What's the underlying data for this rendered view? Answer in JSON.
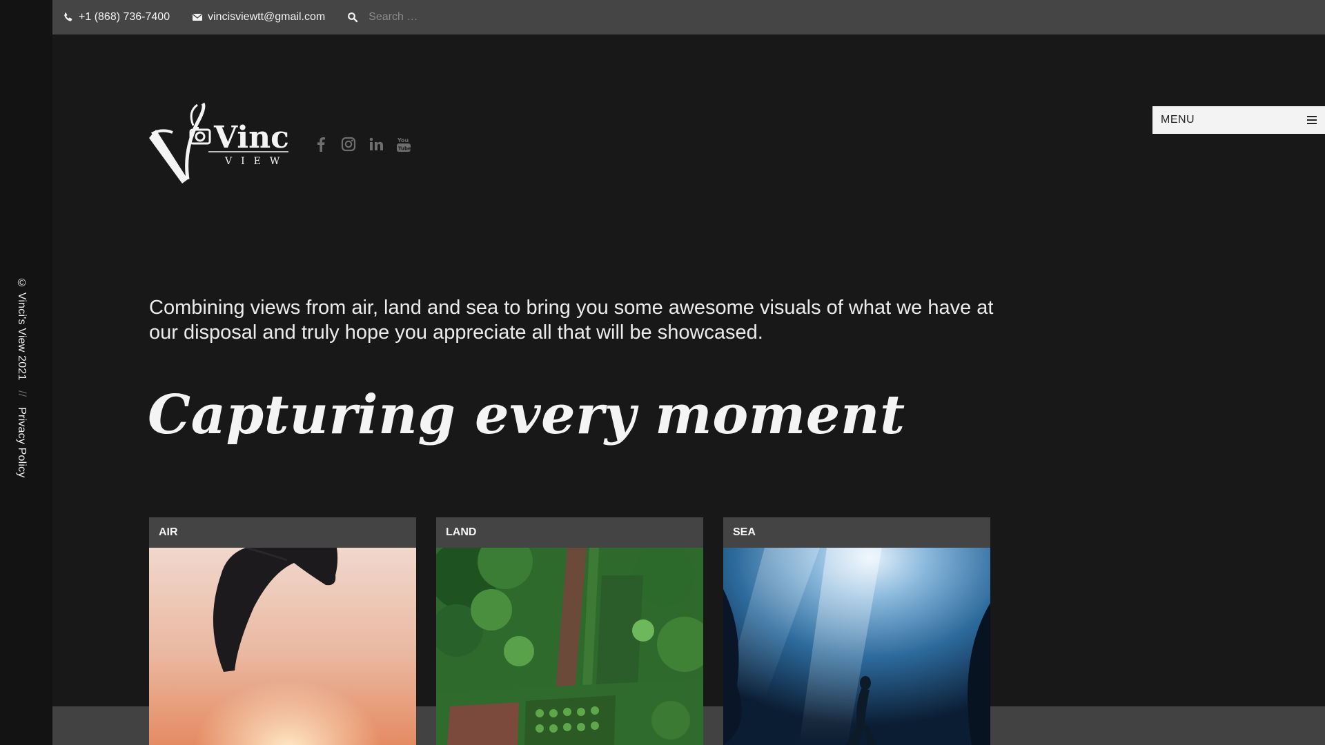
{
  "topbar": {
    "phone": "+1 (868) 736-7400",
    "email": "vincisviewtt@gmail.com",
    "search_placeholder": "Search …"
  },
  "brand": {
    "logo_text": "Vinci's",
    "logo_subtext": "VIEW"
  },
  "social_icons": [
    "facebook-icon",
    "instagram-icon",
    "linkedin-icon",
    "youtube-icon"
  ],
  "menu": {
    "label": "MENU"
  },
  "sidebar": {
    "copyright": "© Vinci's View 2021",
    "separator": "//",
    "privacy": "Privacy Policy"
  },
  "intro": {
    "text": "Combining views from air, land and sea to bring you some awesome visuals of what we have at our disposal and truly hope you appreciate all that will be showcased."
  },
  "headline": "Capturing every moment",
  "cards": [
    {
      "label": "AIR"
    },
    {
      "label": "LAND"
    },
    {
      "label": "SEA"
    }
  ],
  "colors": {
    "background": "#181818",
    "topbar": "#454545",
    "card_header": "#444444",
    "menu_button": "#f3f3f3"
  }
}
